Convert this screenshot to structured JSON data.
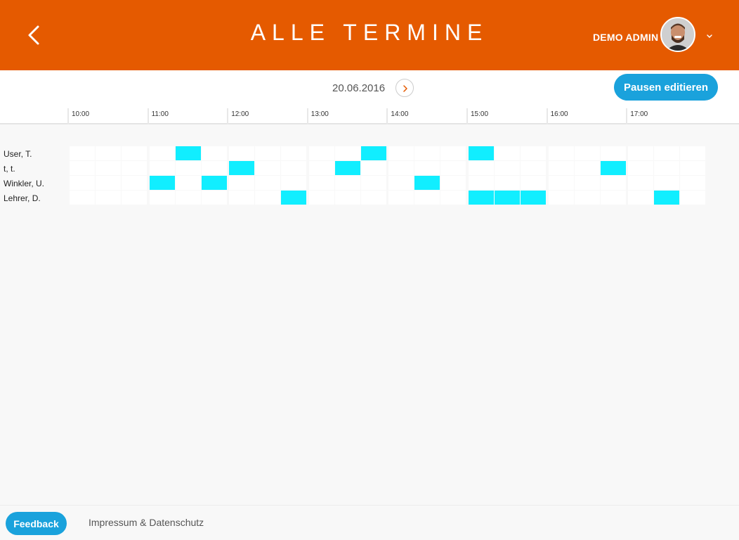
{
  "header": {
    "title": "ALLE TERMINE",
    "user_name": "DEMO ADMIN",
    "accent_color": "#e55a00",
    "back_icon": "chevron-left-icon",
    "menu_icon": "chevron-down-icon"
  },
  "datebar": {
    "date": "20.06.2016",
    "next_icon": "chevron-right-icon",
    "pause_button": "Pausen editieren"
  },
  "timeline": {
    "hours": [
      "10:00",
      "11:00",
      "12:00",
      "13:00",
      "14:00",
      "15:00",
      "16:00",
      "17:00"
    ],
    "slots_per_hour": 3
  },
  "schedule": {
    "booked_color": "#11eeff",
    "rows": [
      {
        "name": "User, T.",
        "booked": [
          4,
          11,
          15
        ]
      },
      {
        "name": "t, t.",
        "booked": [
          6,
          10,
          20
        ]
      },
      {
        "name": "Winkler, U.",
        "booked": [
          3,
          5,
          13
        ]
      },
      {
        "name": "Lehrer, D.",
        "booked": [
          8,
          15,
          16,
          17,
          22
        ]
      }
    ]
  },
  "footer": {
    "feedback": "Feedback",
    "impressum": "Impressum & Datenschutz"
  }
}
